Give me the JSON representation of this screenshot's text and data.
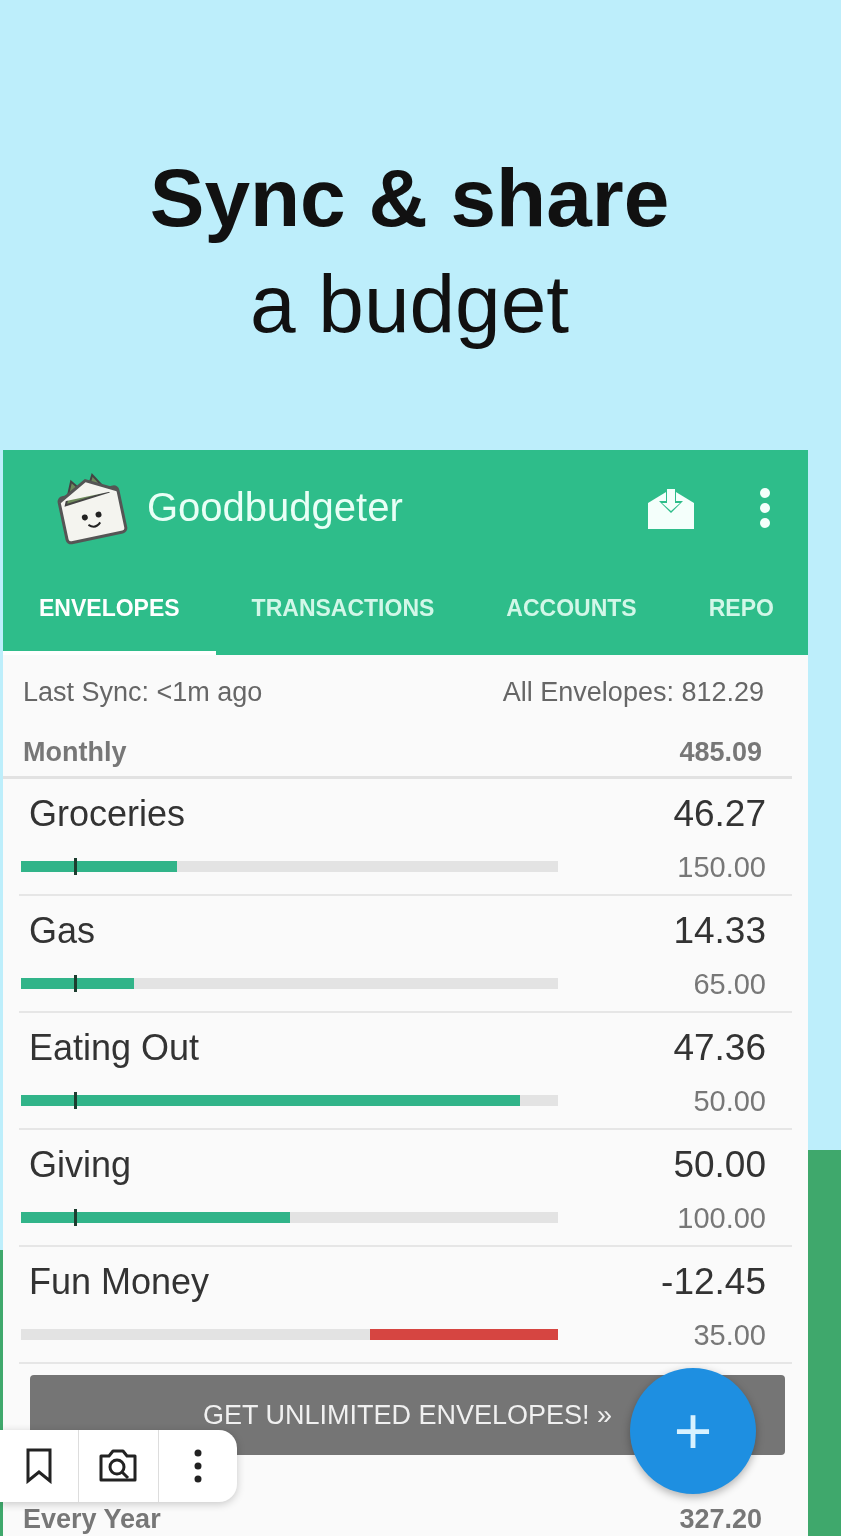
{
  "headline": {
    "line_1": "Sync & share",
    "line_2": "a budget"
  },
  "app_bar": {
    "title": "Goodbudgeter"
  },
  "tabs": [
    {
      "label": "ENVELOPES",
      "selected": true
    },
    {
      "label": "TRANSACTIONS",
      "selected": false
    },
    {
      "label": "ACCOUNTS",
      "selected": false
    },
    {
      "label": "REPO",
      "selected": false
    }
  ],
  "summary": {
    "last_sync": "Last Sync: <1m ago",
    "all_envelopes": "All Envelopes: 812.29"
  },
  "groups": [
    {
      "name": "Monthly",
      "total": "485.09",
      "envelopes": [
        {
          "name": "Groceries",
          "balance": "46.27",
          "budget": "150.00",
          "kind": "positive",
          "level": 0.29
        },
        {
          "name": "Gas",
          "balance": "14.33",
          "budget": "65.00",
          "kind": "positive",
          "level": 0.21
        },
        {
          "name": "Eating Out",
          "balance": "47.36",
          "budget": "50.00",
          "kind": "positive",
          "level": 0.93
        },
        {
          "name": "Giving",
          "balance": "50.00",
          "budget": "100.00",
          "kind": "positive",
          "level": 0.5
        },
        {
          "name": "Fun Money",
          "balance": "-12.45",
          "budget": "35.00",
          "kind": "negative",
          "level": 0.35
        }
      ]
    },
    {
      "name": "Every Year",
      "total": "327.20"
    }
  ],
  "promo_button": "GET UNLIMITED ENVELOPES! »",
  "fab": "+"
}
